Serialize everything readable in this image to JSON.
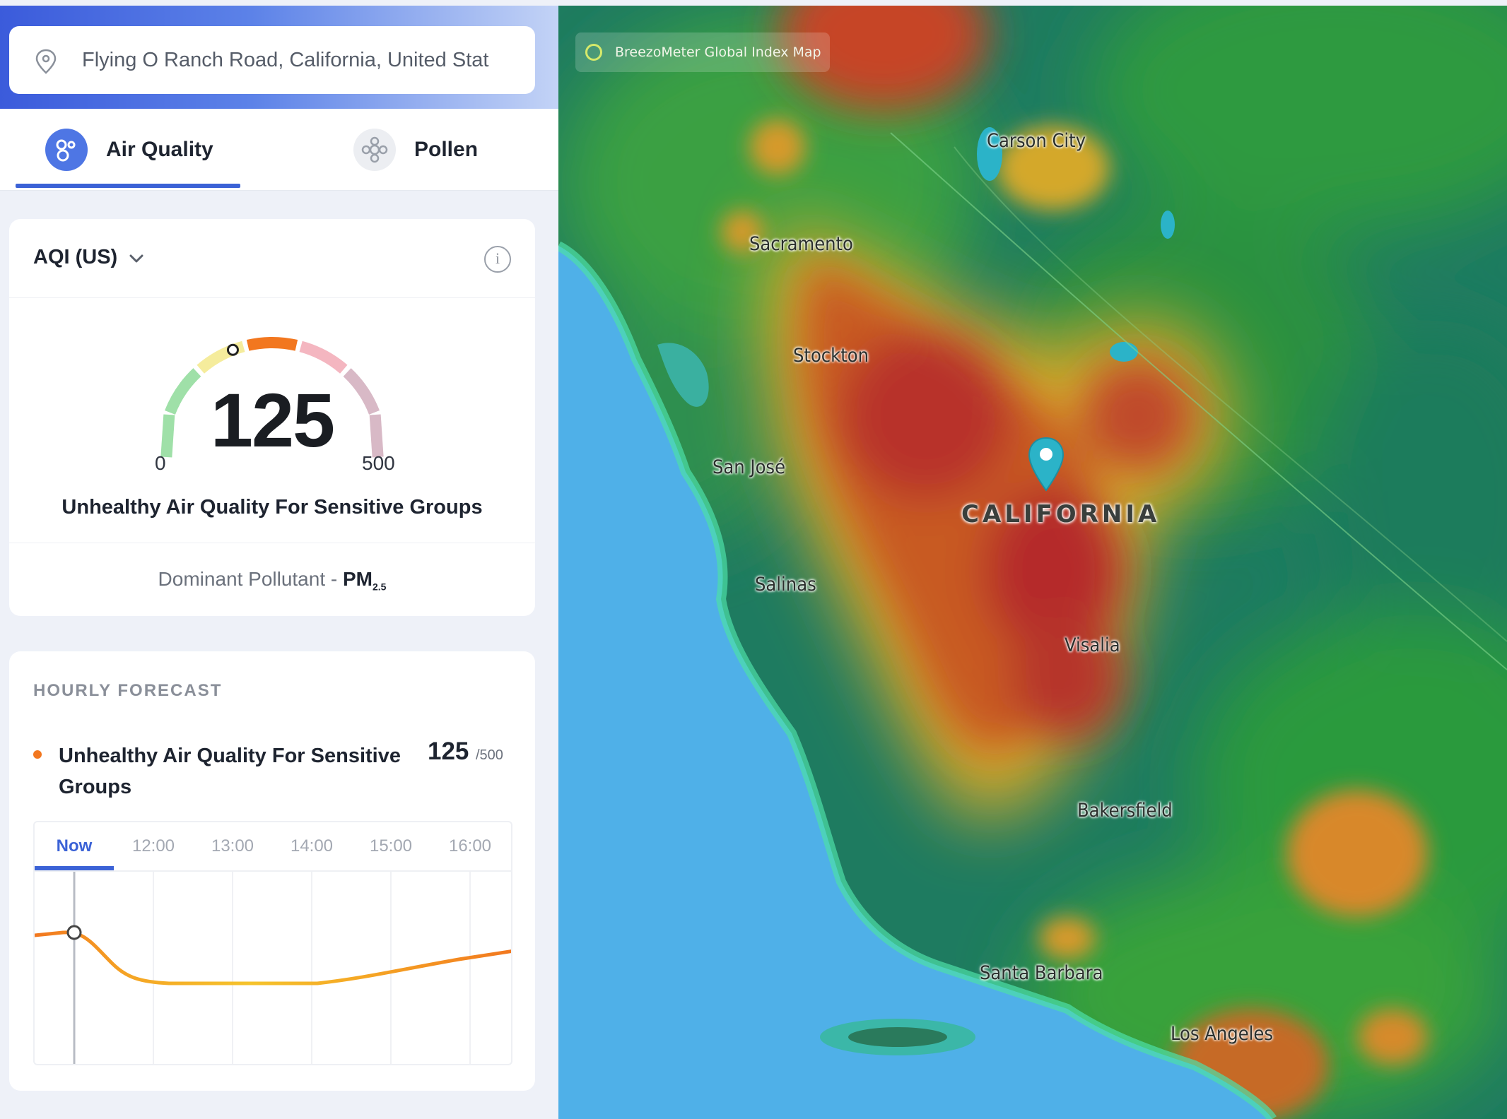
{
  "search": {
    "location": "Flying O Ranch Road, California, United Stat",
    "icon": "location-pin-icon"
  },
  "tabs": [
    {
      "label": "Air Quality",
      "icon": "air-quality-icon",
      "active": true
    },
    {
      "label": "Pollen",
      "icon": "pollen-icon",
      "active": false
    }
  ],
  "aqi_card": {
    "index_label": "AQI (US)",
    "value": "125",
    "scale_min": "0",
    "scale_max": "500",
    "category": "Unhealthy Air Quality For Sensitive Groups",
    "dominant_prefix": "Dominant Pollutant - ",
    "dominant_pollutant": "PM",
    "dominant_subscript": "2.5",
    "gauge_fraction": 0.25,
    "gauge_colors": [
      "#9fe0a8",
      "#f5ec9c",
      "#f2771f",
      "#f4b6c0",
      "#d8b9c6"
    ]
  },
  "forecast": {
    "title": "HOURLY FORECAST",
    "category": "Unhealthy Air Quality For Sensitive Groups",
    "value": "125",
    "max": "/500",
    "times": [
      "Now",
      "12:00",
      "13:00",
      "14:00",
      "15:00",
      "16:00"
    ],
    "selected_time": "Now",
    "line_color_high": "#f2771f",
    "line_color_low": "#f5c32c"
  },
  "map": {
    "badge": "BreezoMeter Global Index Map",
    "state": "CALIFORNIA",
    "cities": [
      "Carson City",
      "Sacramento",
      "Stockton",
      "San José",
      "Salinas",
      "Visalia",
      "Bakersfield",
      "Santa Barbara",
      "Los Angeles"
    ],
    "accent": "#2bb3c8"
  }
}
